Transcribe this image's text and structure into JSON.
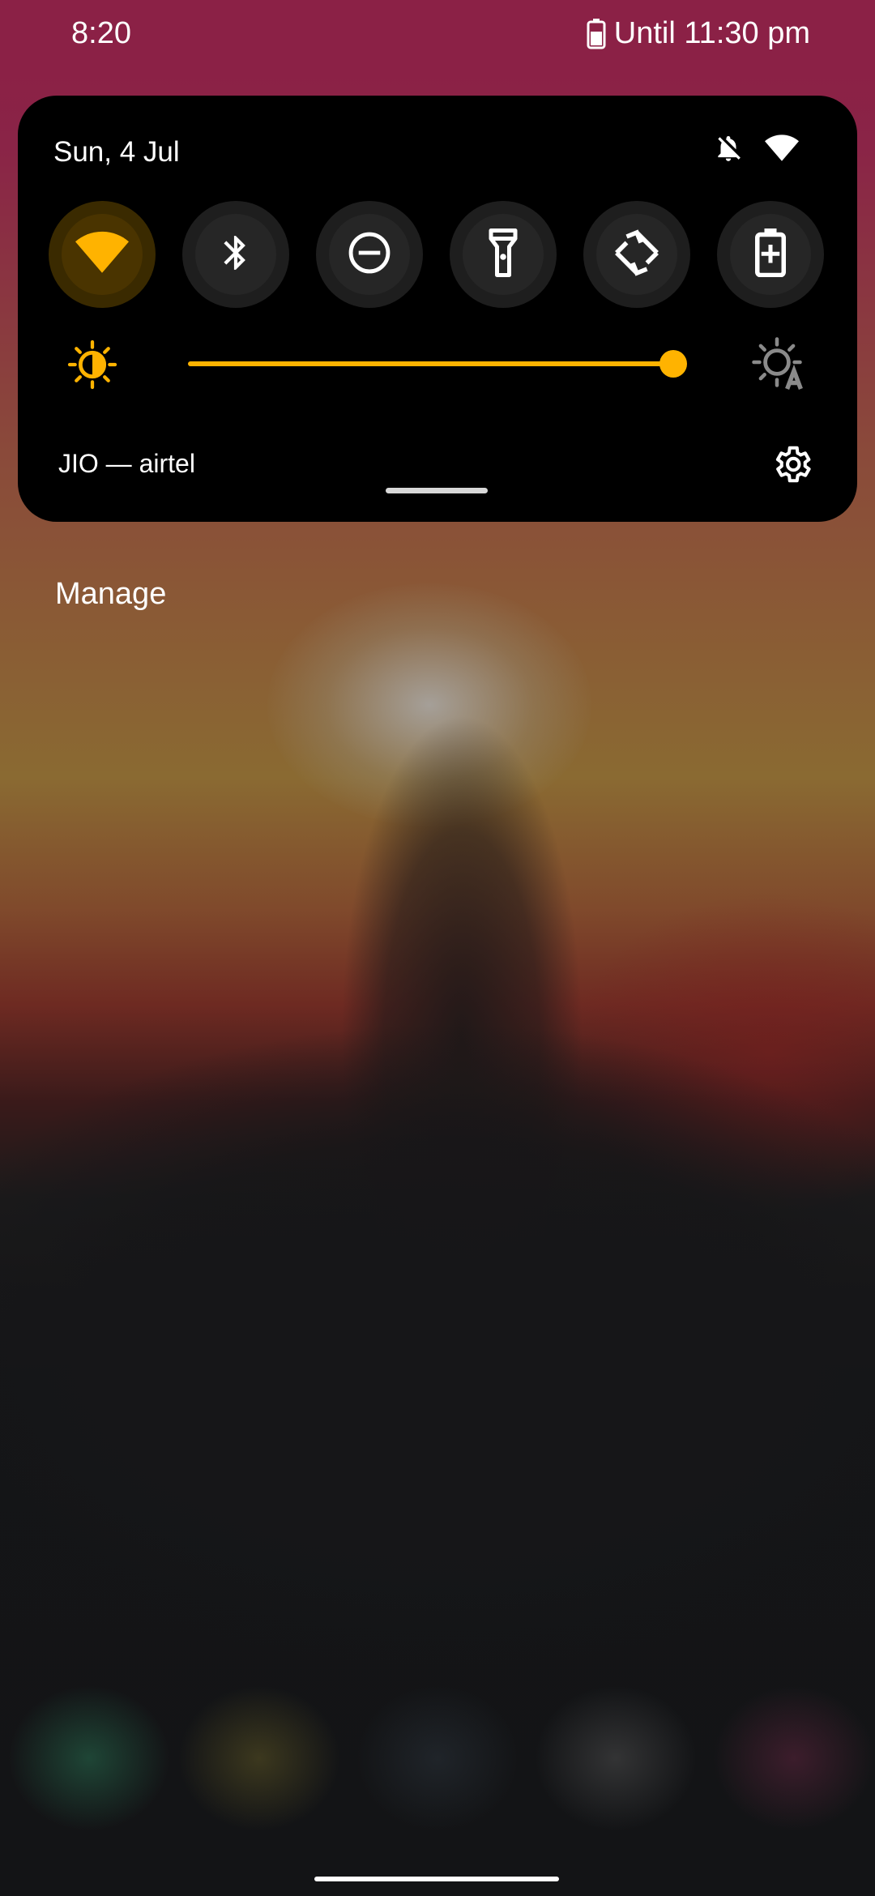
{
  "status_bar": {
    "time": "8:20",
    "battery_text": "Until 11:30 pm",
    "battery_icon": "battery-icon"
  },
  "quick_settings": {
    "date": "Sun, 4 Jul",
    "header_icons": [
      "notifications-off-icon",
      "wifi-icon"
    ],
    "tiles": [
      {
        "name": "wifi",
        "icon": "wifi-icon",
        "active": true
      },
      {
        "name": "bluetooth",
        "icon": "bluetooth-icon",
        "active": false
      },
      {
        "name": "do-not-disturb",
        "icon": "do-not-disturb-icon",
        "active": false
      },
      {
        "name": "flashlight",
        "icon": "flashlight-icon",
        "active": false
      },
      {
        "name": "auto-rotate",
        "icon": "auto-rotate-icon",
        "active": false
      },
      {
        "name": "battery-saver",
        "icon": "battery-saver-icon",
        "active": false
      }
    ],
    "brightness_level": 1.0,
    "carrier_text": "JIO — airtel",
    "settings_icon": "settings-icon"
  },
  "notifications": {
    "manage_label": "Manage"
  },
  "colors": {
    "accent": "#FFB300",
    "panel_bg": "#000000",
    "status_bar_bg": "#8B2146"
  }
}
